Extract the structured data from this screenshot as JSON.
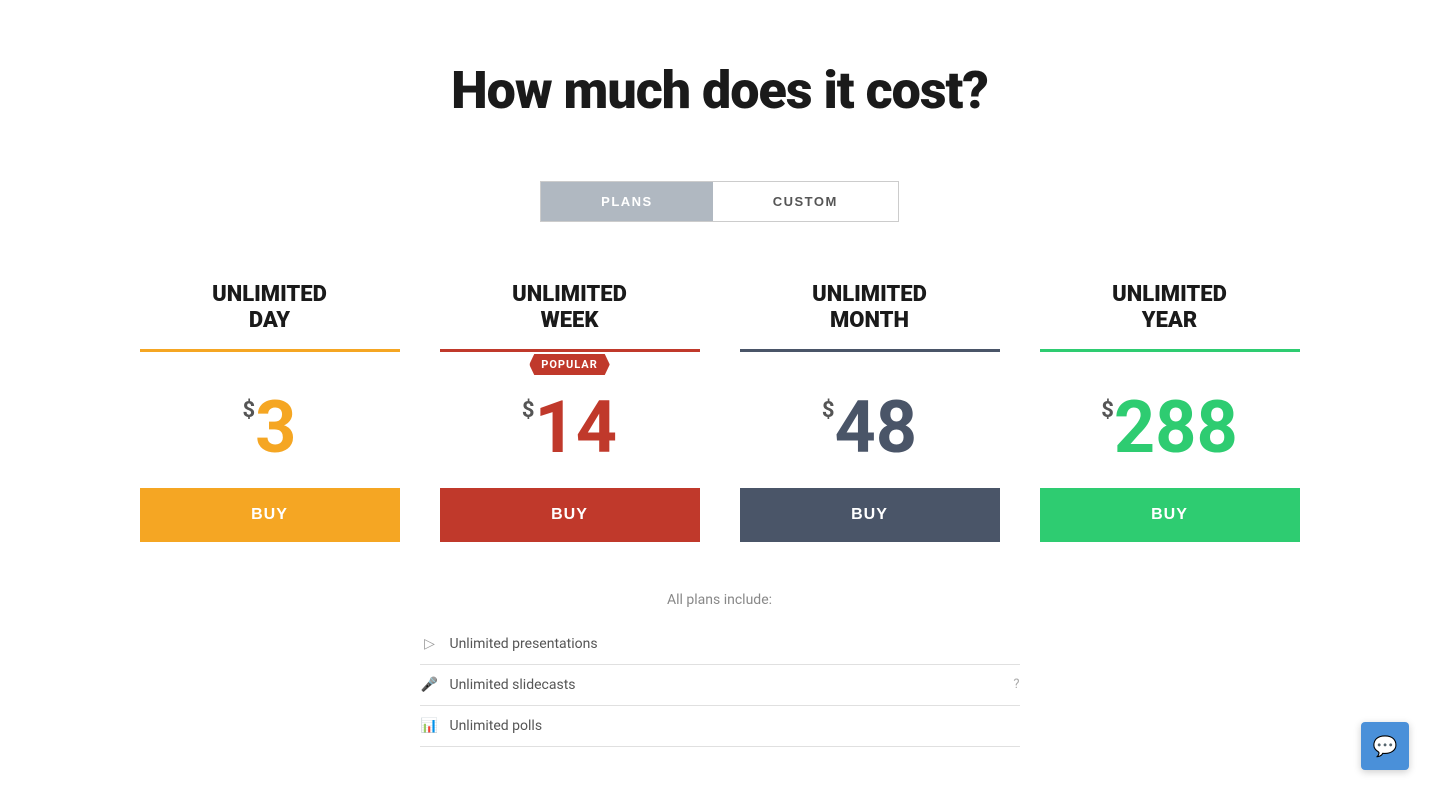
{
  "page": {
    "title": "How much does it cost?"
  },
  "toggle": {
    "plans_label": "PLANS",
    "custom_label": "CUSTOM"
  },
  "plans": [
    {
      "id": "day",
      "name_line1": "UNLIMITED",
      "name_line2": "DAY",
      "color_class": "orange",
      "price_dollar": "$",
      "price": "3",
      "buy_label": "BUY",
      "popular": false
    },
    {
      "id": "week",
      "name_line1": "UNLIMITED",
      "name_line2": "WEEK",
      "color_class": "red",
      "price_dollar": "$",
      "price": "14",
      "buy_label": "BUY",
      "popular": true,
      "popular_text": "POPULAR"
    },
    {
      "id": "month",
      "name_line1": "UNLIMITED",
      "name_line2": "MONTH",
      "color_class": "dark-blue",
      "price_dollar": "$",
      "price": "48",
      "buy_label": "BUY",
      "popular": false
    },
    {
      "id": "year",
      "name_line1": "UNLIMITED",
      "name_line2": "YEAR",
      "color_class": "green",
      "price_dollar": "$",
      "price": "288",
      "buy_label": "BUY",
      "popular": false
    }
  ],
  "features": {
    "header": "All plans include:",
    "items": [
      {
        "icon": "▷",
        "text": "Unlimited presentations",
        "help": null
      },
      {
        "icon": "🎤",
        "text": "Unlimited slidecasts",
        "help": "?"
      },
      {
        "icon": "📊",
        "text": "Unlimited polls",
        "help": null
      }
    ]
  },
  "chat": {
    "icon": "💬"
  }
}
